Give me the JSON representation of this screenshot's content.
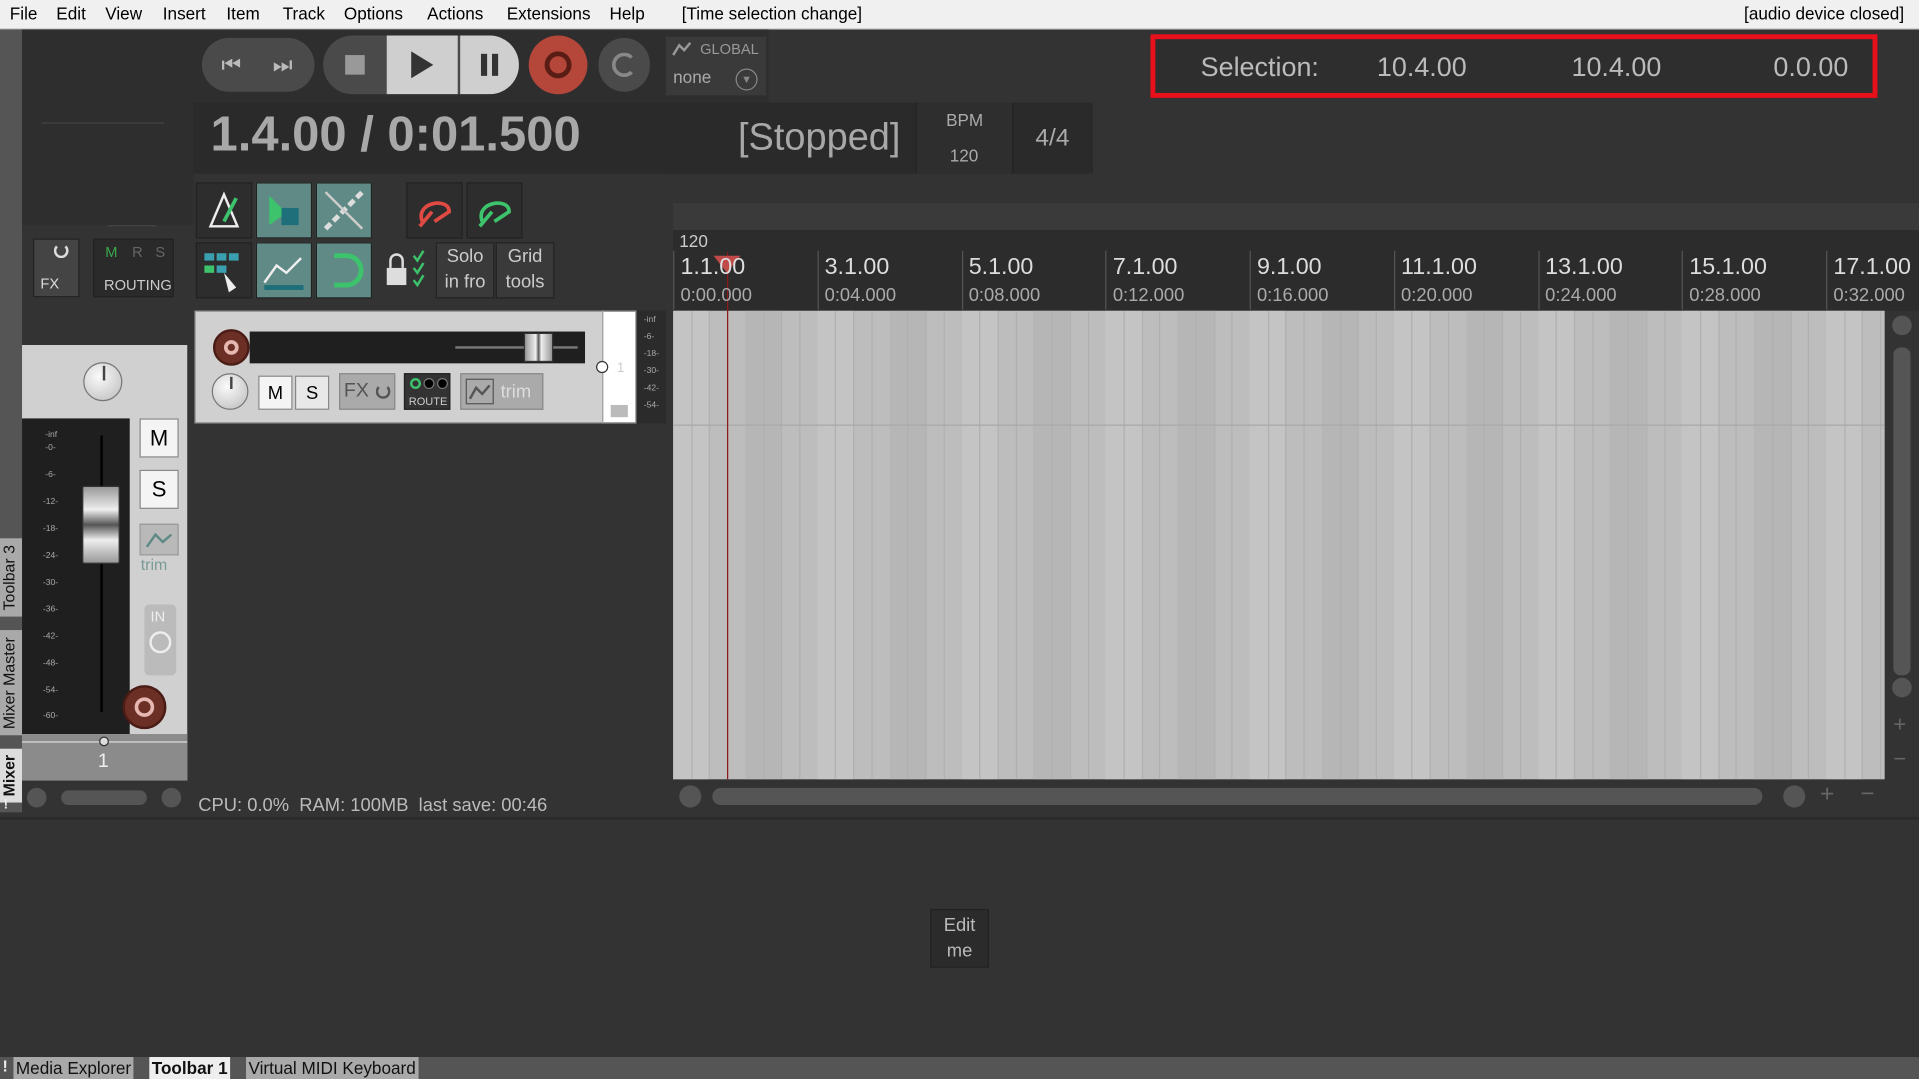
{
  "menubar": {
    "items": [
      "File",
      "Edit",
      "View",
      "Insert",
      "Item",
      "Track",
      "Options",
      "Actions",
      "Extensions",
      "Help"
    ],
    "status": "[Time selection change]",
    "audio_status": "[audio device closed]"
  },
  "transport": {
    "global_label": "GLOBAL",
    "sync_value": "none",
    "position": "1.4.00 / 0:01.500",
    "state": "[Stopped]",
    "bpm_label": "BPM",
    "bpm_value": "120",
    "time_signature": "4/4"
  },
  "selection": {
    "label": "Selection:",
    "start": "10.4.00",
    "end": "10.4.00",
    "length": "0.0.00"
  },
  "toolbar": {
    "solo_line1": "Solo",
    "solo_line2": "in fro",
    "grid_line1": "Grid",
    "grid_line2": "tools"
  },
  "master": {
    "fx_label": "FX",
    "m_label": "M",
    "r_label": "R",
    "s_label": "S",
    "routing_label": "ROUTING",
    "mute_label": "M",
    "solo_label": "S",
    "trim_label": "trim",
    "in_label": "IN",
    "track_number": "1",
    "scale": [
      "-inf",
      "-0-",
      "-6-",
      "-12-",
      "-18-",
      "-24-",
      "-30-",
      "-36-",
      "-42-",
      "-48-",
      "-54-",
      "-60-"
    ]
  },
  "track": {
    "mute_label": "M",
    "solo_label": "S",
    "fx_label": "FX",
    "route_label": "ROUTE",
    "trim_label": "trim",
    "number": "1",
    "meter_scale": [
      "-inf",
      "-6-",
      "-18-",
      "-30-",
      "-42-",
      "-54-"
    ]
  },
  "ruler": {
    "tempo": "120",
    "markers": [
      {
        "measure": "1.1.00",
        "time": "0:00.000"
      },
      {
        "measure": "3.1.00",
        "time": "0:04.000"
      },
      {
        "measure": "5.1.00",
        "time": "0:08.000"
      },
      {
        "measure": "7.1.00",
        "time": "0:12.000"
      },
      {
        "measure": "9.1.00",
        "time": "0:16.000"
      },
      {
        "measure": "11.1.00",
        "time": "0:20.000"
      },
      {
        "measure": "13.1.00",
        "time": "0:24.000"
      },
      {
        "measure": "15.1.00",
        "time": "0:28.000"
      },
      {
        "measure": "17.1.00",
        "time": "0:32.000"
      }
    ]
  },
  "status_bar": {
    "text": "CPU: 0.0%  RAM: 100MB  last save: 00:46"
  },
  "dock": {
    "edit_line1": "Edit",
    "edit_line2": "me",
    "bottom_tabs": [
      "Media Explorer",
      "Toolbar 1",
      "Virtual MIDI Keyboard"
    ],
    "side_tabs": [
      "Toolbar 3",
      "Mixer Master",
      "Mixer"
    ],
    "bang": "!"
  },
  "colors": {
    "highlight_box": "#e8101a",
    "active_tool": "#5f8a86",
    "record_red": "#b5463a",
    "arrange_bg": "#bdbdbd"
  }
}
